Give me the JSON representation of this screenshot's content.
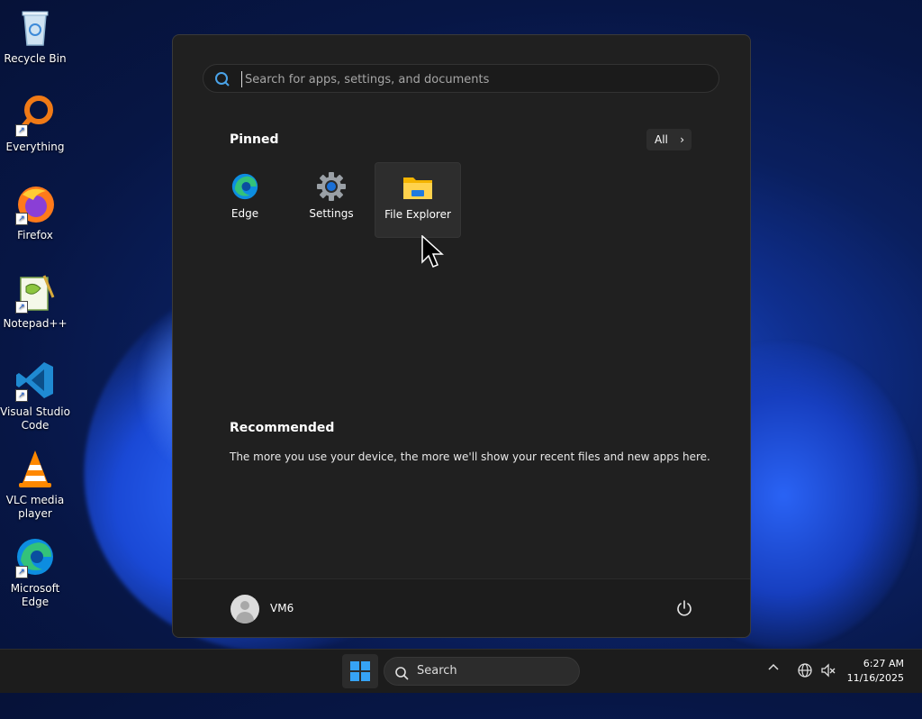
{
  "desktop": {
    "icons": [
      {
        "label": "Recycle Bin",
        "icon": "recycle-bin-icon"
      },
      {
        "label": "Everything",
        "icon": "everything-search-icon"
      },
      {
        "label": "Firefox",
        "icon": "firefox-icon"
      },
      {
        "label": "Notepad++",
        "icon": "notepadpp-icon"
      },
      {
        "label": "Visual Studio Code",
        "icon": "vscode-icon"
      },
      {
        "label": "VLC media player",
        "icon": "vlc-icon"
      },
      {
        "label": "Microsoft Edge",
        "icon": "edge-icon"
      }
    ]
  },
  "start_menu": {
    "search_placeholder": "Search for apps, settings, and documents",
    "pinned_title": "Pinned",
    "all_button": "All",
    "pinned": [
      {
        "label": "Edge",
        "icon": "edge-icon"
      },
      {
        "label": "Settings",
        "icon": "gear-icon"
      },
      {
        "label": "File Explorer",
        "icon": "folder-icon"
      }
    ],
    "recommended_title": "Recommended",
    "recommended_text": "The more you use your device, the more we'll show your recent files and new apps here.",
    "user_name": "VM6"
  },
  "taskbar": {
    "search_label": "Search",
    "time": "6:27 AM",
    "date": "11/16/2025"
  },
  "colors": {
    "accent": "#36a3f5",
    "start_bg": "#202020",
    "taskbar_bg": "#1c1c1c"
  }
}
